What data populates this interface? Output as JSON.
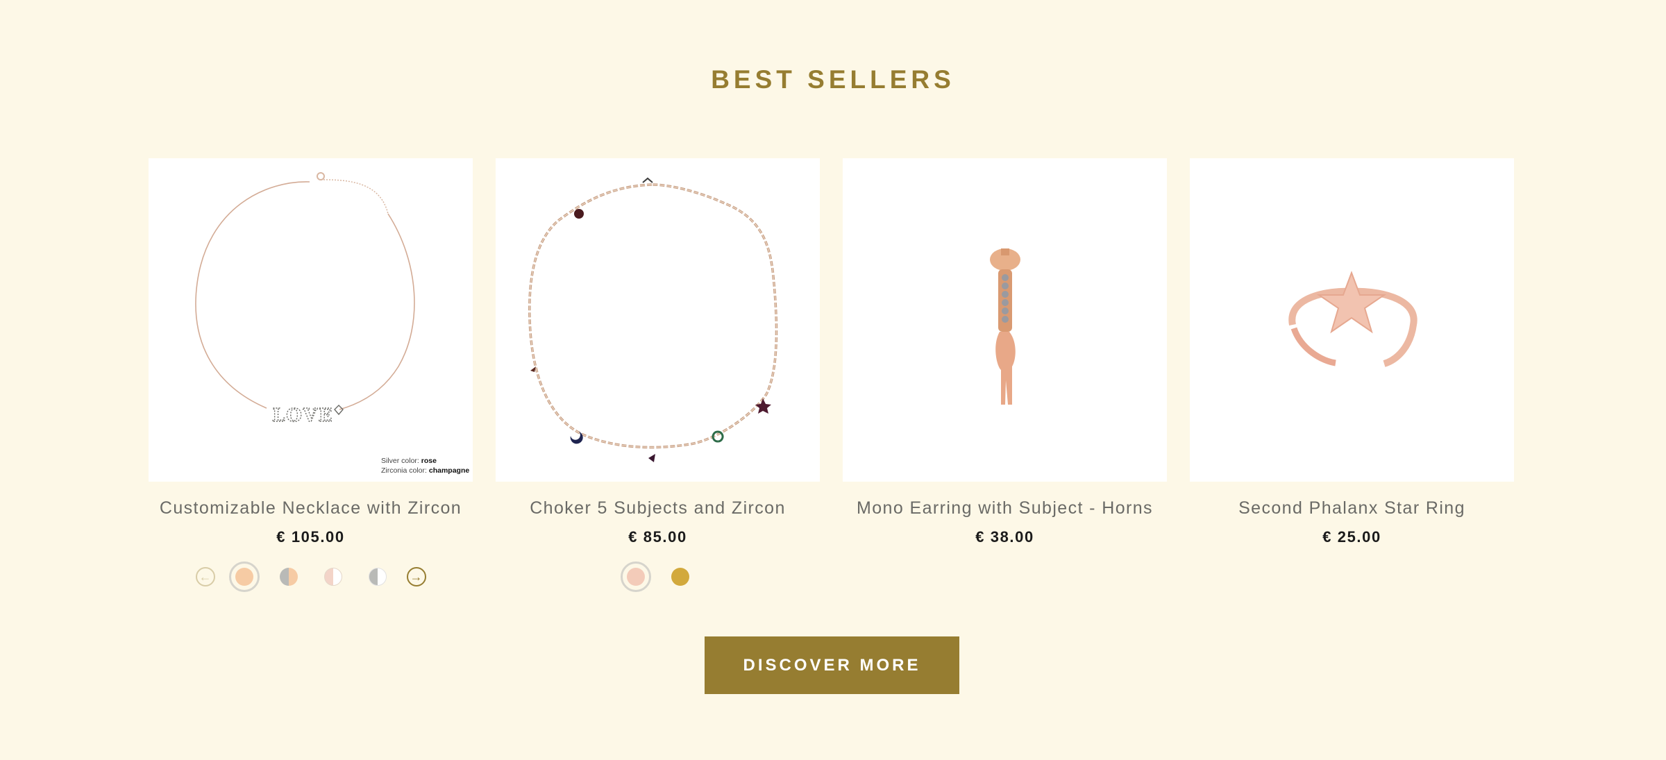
{
  "section": {
    "title": "BEST SELLERS"
  },
  "products": [
    {
      "name": "Customizable Necklace with Zircon",
      "price": "€ 105.00",
      "image_caption": {
        "line1_label": "Silver color: ",
        "line1_value": "rose",
        "line2_label": "Zirconia color: ",
        "line2_value": "champagne"
      },
      "swatches": [
        {
          "colors": [
            "#f6cba4",
            "#f6cba4"
          ],
          "selected": true
        },
        {
          "colors": [
            "#b9bab7",
            "#f6cba4"
          ],
          "selected": false
        },
        {
          "colors": [
            "#f3d4c8",
            "#ffffff"
          ],
          "selected": false
        },
        {
          "colors": [
            "#b9bab7",
            "#ffffff"
          ],
          "selected": false
        }
      ]
    },
    {
      "name": "Choker 5 Subjects and Zircon",
      "price": "€ 85.00",
      "swatches": [
        {
          "colors": [
            "#f3cbb9",
            "#f3cbb9"
          ],
          "selected": true
        },
        {
          "colors": [
            "#d2a93c",
            "#d2a93c"
          ],
          "selected": false
        }
      ]
    },
    {
      "name": "Mono Earring with Subject - Horns",
      "price": "€ 38.00",
      "swatches": []
    },
    {
      "name": "Second Phalanx Star Ring",
      "price": "€ 25.00",
      "swatches": []
    }
  ],
  "swatch_nav": {
    "prev_icon": "arrow-left-circle-icon",
    "next_icon": "arrow-right-circle-icon"
  },
  "cta": {
    "label": "DISCOVER MORE"
  },
  "colors": {
    "background": "#fdf8e7",
    "accent": "#967d31"
  }
}
